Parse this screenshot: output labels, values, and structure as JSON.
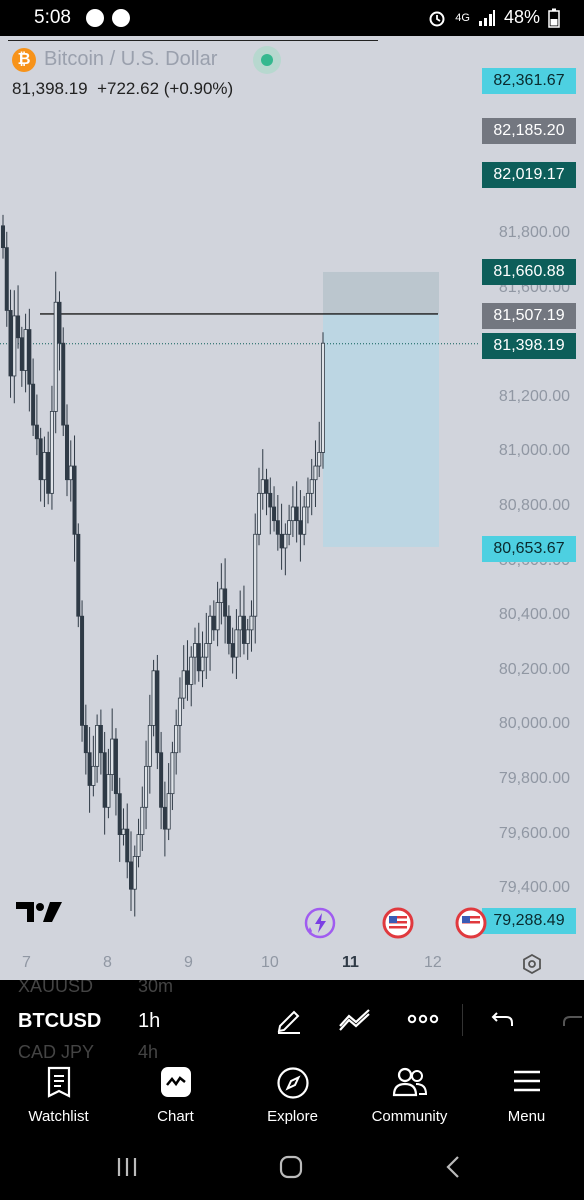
{
  "status_bar": {
    "time": "5:08",
    "network": "4G",
    "battery": "48%"
  },
  "chart_header": {
    "title": "Bitcoin / U.S. Dollar",
    "price": "81,398.19",
    "change": "+722.62 (+0.90%)"
  },
  "price_tags": [
    {
      "label": "82,361.67",
      "color": "#4dd0e1",
      "text_color": "#0a2a2e"
    },
    {
      "label": "82,185.20",
      "color": "#737780",
      "text_color": "#ffffff"
    },
    {
      "label": "82,019.17",
      "color": "#0d5e5a",
      "text_color": "#ffffff"
    },
    {
      "label": "81,660.88",
      "color": "#0d5e5a",
      "text_color": "#ffffff"
    },
    {
      "label": "81,507.19",
      "color": "#737780",
      "text_color": "#ffffff"
    },
    {
      "label": "81,398.19",
      "color": "#0d5e5a",
      "text_color": "#ffffff"
    },
    {
      "label": "80,653.67",
      "color": "#4dd0e1",
      "text_color": "#0a2a2e"
    },
    {
      "label": "79,288.49",
      "color": "#4dd0e1",
      "text_color": "#0a2a2e"
    }
  ],
  "price_axis": [
    "81,800.00",
    "81,600.00",
    "81,400.00",
    "81,200.00",
    "81,000.00",
    "80,800.00",
    "80,600.00",
    "80,400.00",
    "80,200.00",
    "80,000.00",
    "79,800.00",
    "79,600.00",
    "79,400.00"
  ],
  "time_axis": [
    "7",
    "8",
    "9",
    "10",
    "11",
    "12"
  ],
  "chart_data": {
    "type": "candlestick",
    "symbol": "BTCUSD",
    "interval": "1h",
    "y_axis_ticks": [
      81800,
      81600,
      81400,
      81200,
      81000,
      80800,
      80600,
      80400,
      80200,
      80000,
      79800,
      79600,
      79400
    ],
    "ylim": [
      79230,
      82580
    ],
    "x_axis_ticks": [
      "7",
      "8",
      "9",
      "10",
      "11",
      "12"
    ],
    "last_price": 81398.19,
    "horizontal_line": 81507.19,
    "position_box": {
      "entry": 81507.19,
      "target": 81660.88,
      "stop": 80653.67
    },
    "close_series": [
      81750,
      81520,
      81280,
      81500,
      81420,
      81300,
      81450,
      81250,
      81100,
      81050,
      80900,
      81000,
      80850,
      81150,
      81550,
      81400,
      81100,
      80900,
      80950,
      80700,
      80400,
      80000,
      79900,
      79780,
      79850,
      80000,
      79900,
      79700,
      79820,
      79950,
      79750,
      79600,
      79620,
      79500,
      79400,
      79520,
      79600,
      79700,
      79850,
      80000,
      80200,
      79900,
      79700,
      79620,
      79750,
      79900,
      80000,
      80100,
      80200,
      80150,
      80250,
      80300,
      80200,
      80250,
      80300,
      80400,
      80350,
      80450,
      80500,
      80400,
      80300,
      80250,
      80350,
      80400,
      80300,
      80350,
      80400,
      80700,
      80850,
      80900,
      80850,
      80800,
      80750,
      80700,
      80650,
      80700,
      80750,
      80800,
      80750,
      80700,
      80800,
      80850,
      80900,
      80950,
      81000,
      81400
    ]
  },
  "symbols": {
    "ghost_above": {
      "symbol": "XAUUSD",
      "interval": "30m"
    },
    "current": {
      "symbol": "BTCUSD",
      "interval": "1h"
    },
    "ghost_below": {
      "symbol": "CAD JPY",
      "interval": "4h"
    }
  },
  "tools": [
    "pencil-icon",
    "trend-line-icon",
    "more-icon",
    "undo-icon",
    "redo-icon"
  ],
  "nav": [
    {
      "label": "Watchlist",
      "icon": "watchlist-icon"
    },
    {
      "label": "Chart",
      "icon": "chart-icon"
    },
    {
      "label": "Explore",
      "icon": "compass-icon"
    },
    {
      "label": "Community",
      "icon": "community-icon"
    },
    {
      "label": "Menu",
      "icon": "menu-icon"
    }
  ]
}
